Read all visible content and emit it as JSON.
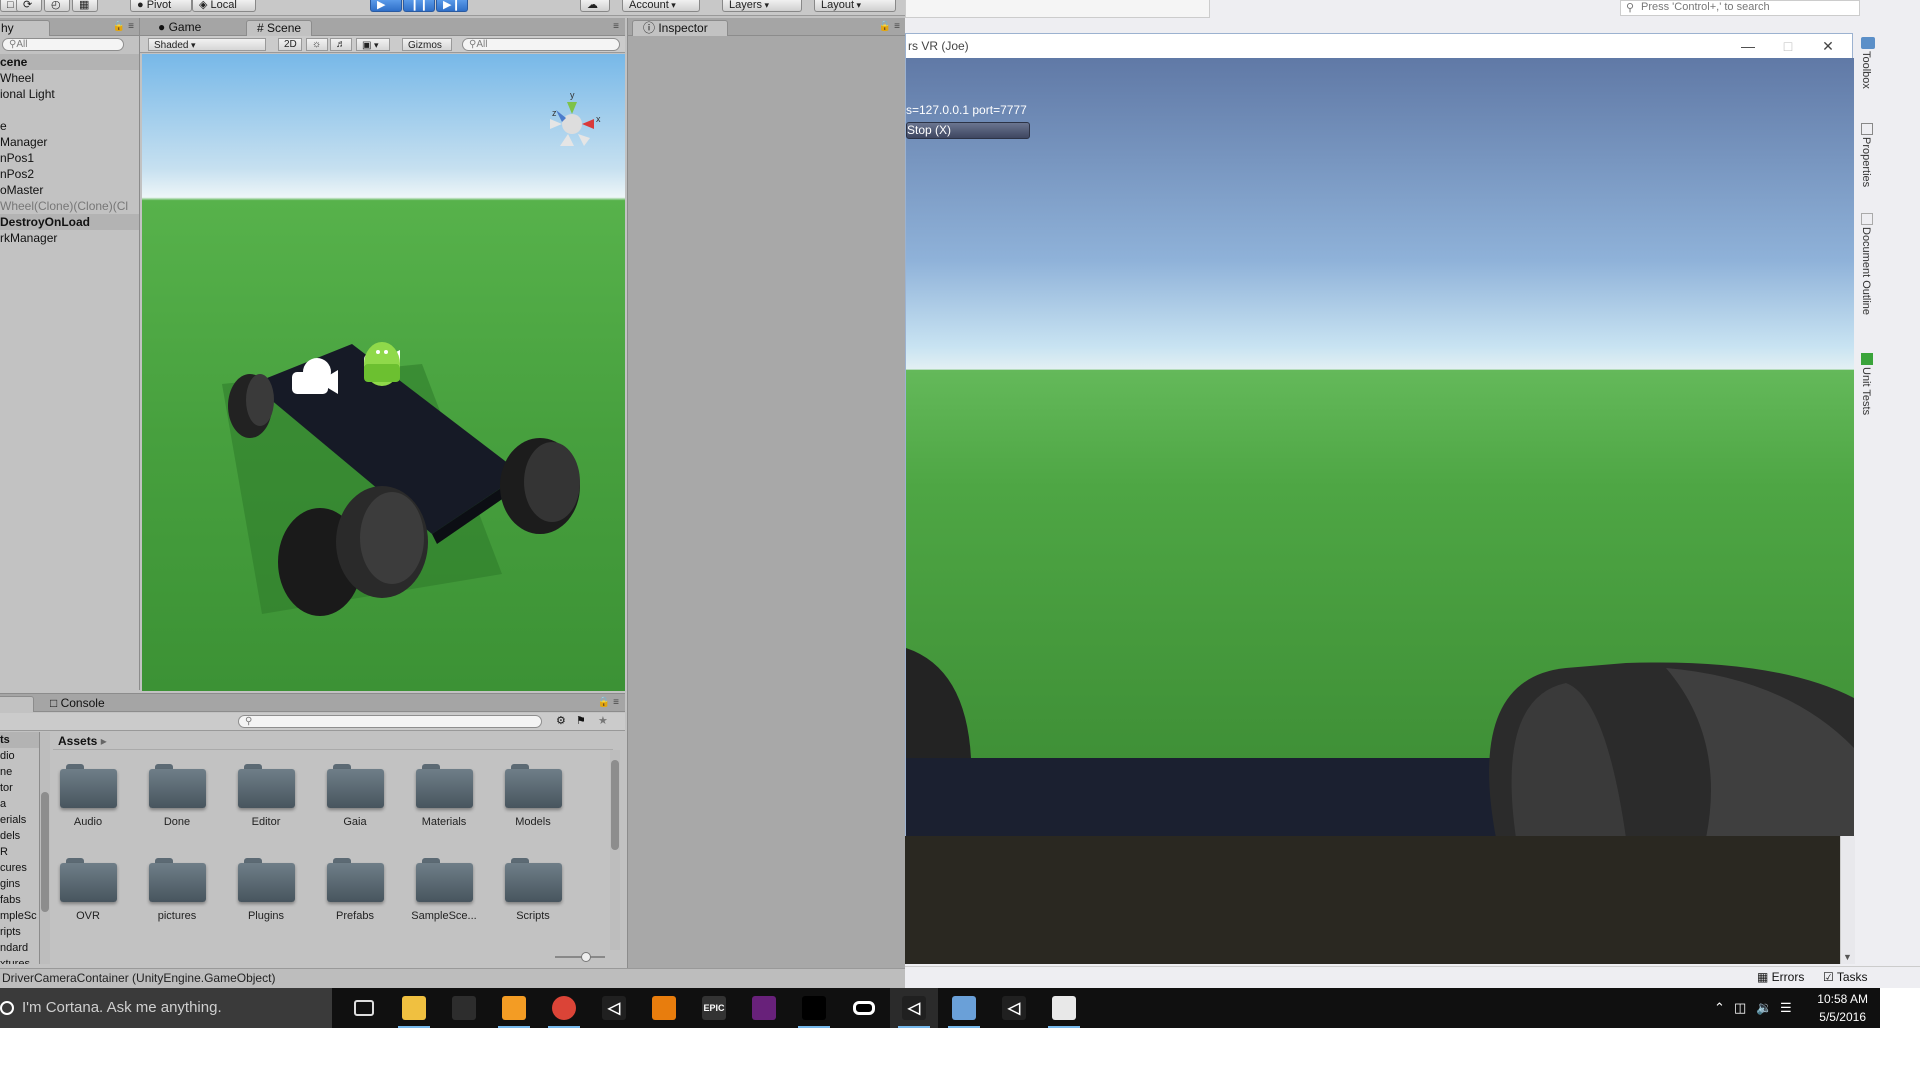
{
  "unity": {
    "toolbar": {
      "pivot": "Pivot",
      "local": "Local",
      "account": "Account",
      "layers": "Layers",
      "layout": "Layout"
    },
    "hierarchy": {
      "tab": "hy",
      "search_placeholder": "All",
      "items": [
        {
          "label": "cene",
          "kind": "scene"
        },
        {
          "label": "Wheel",
          "kind": "normal"
        },
        {
          "label": "ional Light",
          "kind": "normal"
        },
        {
          "label": "",
          "kind": "normal"
        },
        {
          "label": "e",
          "kind": "normal"
        },
        {
          "label": "Manager",
          "kind": "normal"
        },
        {
          "label": "nPos1",
          "kind": "normal"
        },
        {
          "label": "nPos2",
          "kind": "normal"
        },
        {
          "label": "oMaster",
          "kind": "normal"
        },
        {
          "label": "Wheel(Clone)(Clone)(Cl",
          "kind": "gray"
        },
        {
          "label": "DestroyOnLoad",
          "kind": "scene"
        },
        {
          "label": "rkManager",
          "kind": "normal"
        }
      ]
    },
    "scene": {
      "tabs": [
        "Game",
        "Scene"
      ],
      "shading": "Shaded",
      "mode_2d": "2D",
      "gizmos": "Gizmos",
      "search_placeholder": "All",
      "gizmo_axes": {
        "y": "y",
        "x": "x",
        "z": "z"
      }
    },
    "inspector": {
      "tab": "Inspector"
    },
    "project": {
      "tabs": [
        "",
        "Console"
      ],
      "breadcrumb": "Assets",
      "tree": [
        "ts",
        "dio",
        "ne",
        "tor",
        "a",
        "erials",
        "dels",
        "R",
        "cures",
        "gins",
        "fabs",
        "mpleSc",
        "ripts",
        "ndard",
        "xtures"
      ],
      "folders": [
        "Audio",
        "Done",
        "Editor",
        "Gaia",
        "Materials",
        "Models",
        "OVR",
        "pictures",
        "Plugins",
        "Prefabs",
        "SampleSce...",
        "Scripts"
      ]
    },
    "status": "DriverCameraContainer (UnityEngine.GameObject)"
  },
  "vs": {
    "search_placeholder": "Press 'Control+,' to search",
    "game_window_title": "rs VR (Joe)",
    "overlay": {
      "address": "s=127.0.0.1 port=7777",
      "stop_button": "Stop (X)"
    },
    "side_tabs": [
      "Toolbox",
      "Properties",
      "Document Outline",
      "Unit Tests"
    ],
    "status": {
      "errors": "Errors",
      "tasks": "Tasks"
    }
  },
  "taskbar": {
    "cortana": "I'm Cortana. Ask me anything.",
    "apps": [
      {
        "name": "task-view",
        "label": ""
      },
      {
        "name": "file-explorer",
        "label": ""
      },
      {
        "name": "store",
        "label": ""
      },
      {
        "name": "sublime",
        "label": ""
      },
      {
        "name": "chrome",
        "label": ""
      },
      {
        "name": "unity",
        "label": ""
      },
      {
        "name": "blender",
        "label": ""
      },
      {
        "name": "epic",
        "label": "EPIC"
      },
      {
        "name": "visual-studio-purple",
        "label": ""
      },
      {
        "name": "cmd",
        "label": ""
      },
      {
        "name": "oculus",
        "label": ""
      },
      {
        "name": "unity-2",
        "label": ""
      },
      {
        "name": "monodevelop",
        "label": ""
      },
      {
        "name": "unity-3",
        "label": ""
      },
      {
        "name": "paint",
        "label": ""
      }
    ],
    "time": "10:58 AM",
    "date": "5/5/2016"
  }
}
